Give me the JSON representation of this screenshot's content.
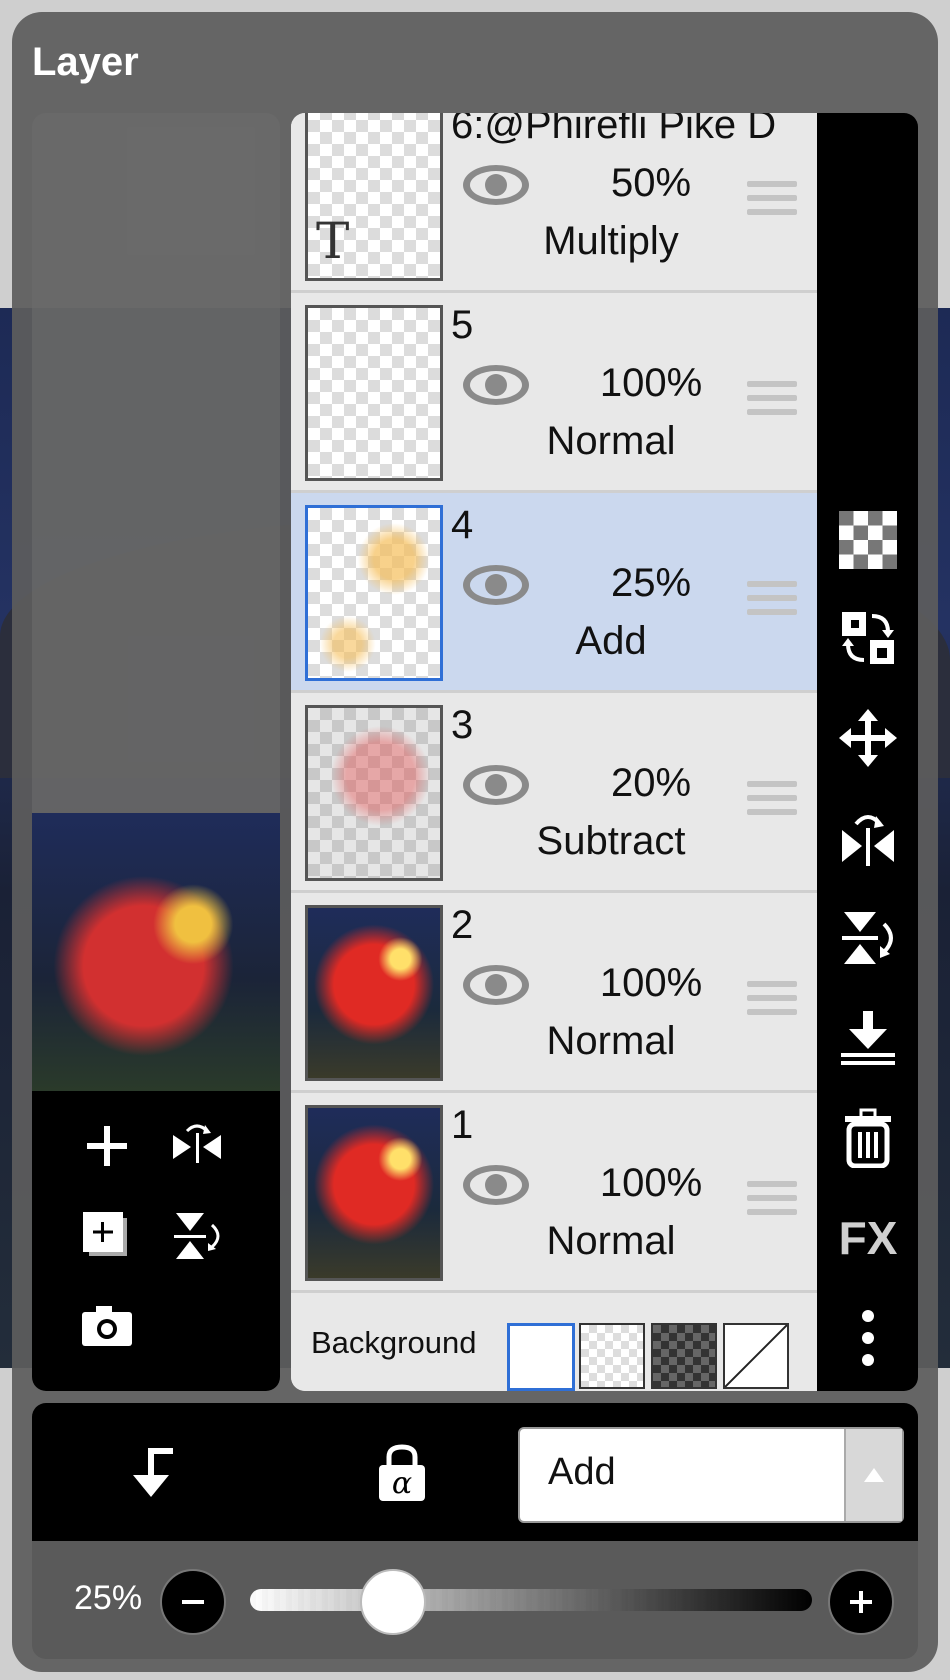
{
  "dialog": {
    "title": "Layer"
  },
  "layers": [
    {
      "name": "6:@Phirefli Pike D",
      "opacity": "50%",
      "blend": "Multiply",
      "thumb": "text-layer",
      "selected": false
    },
    {
      "name": "5",
      "opacity": "100%",
      "blend": "Normal",
      "thumb": "transparent",
      "selected": false
    },
    {
      "name": "4",
      "opacity": "25%",
      "blend": "Add",
      "thumb": "glow",
      "selected": true
    },
    {
      "name": "3",
      "opacity": "20%",
      "blend": "Subtract",
      "thumb": "faded",
      "selected": false
    },
    {
      "name": "2",
      "opacity": "100%",
      "blend": "Normal",
      "thumb": "artwork",
      "selected": false
    },
    {
      "name": "1",
      "opacity": "100%",
      "blend": "Normal",
      "thumb": "artwork",
      "selected": false
    }
  ],
  "text_layer_glyph": "T",
  "background": {
    "label": "Background",
    "options": [
      "white",
      "transparent-light",
      "transparent-dark",
      "none"
    ],
    "selected": "white"
  },
  "right_tools": [
    "transparency-icon",
    "swap-icon",
    "move-icon",
    "flip-horizontal-icon",
    "flip-vertical-icon",
    "merge-down-icon",
    "trash-icon",
    "FX",
    "more-icon"
  ],
  "left_tools": [
    "add-layer-icon",
    "flip-horizontal-icon",
    "duplicate-layer-icon",
    "flip-vertical-icon",
    "camera-icon"
  ],
  "bottom": {
    "clip_icon": "clipping-icon",
    "lock_label": "α",
    "blend_mode": "Add"
  },
  "opacity_slider": {
    "label": "25%",
    "value": 25,
    "minus": "−",
    "plus": "+"
  }
}
